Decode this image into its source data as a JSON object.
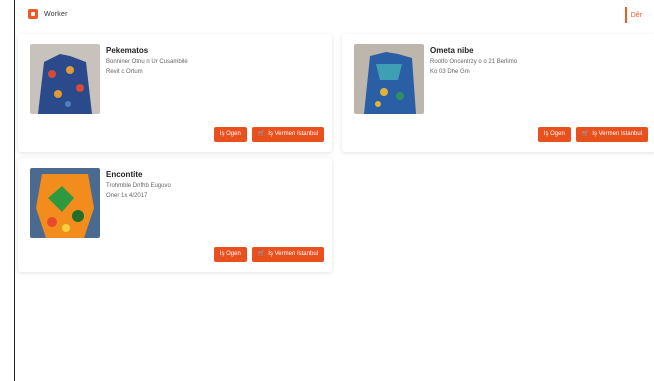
{
  "header": {
    "brand": "Worker",
    "right_label": "Dêr"
  },
  "cards": [
    {
      "title": "Pekematos",
      "line1": "Bonniner Otnu n Ur Cusambile",
      "line2": "Revit c Ortum",
      "btn_primary": "Iş Ogen",
      "btn_secondary": "Iş Vermen Istanbul"
    },
    {
      "title": "Ometa nibe",
      "line1": "Rootfo Oncentrzy o o 21 Berlimo",
      "line2": "Ko 03 Dhe Gm",
      "btn_primary": "Iş Ogen",
      "btn_secondary": "Iş Vermen Istanbul"
    },
    {
      "title": "Encontite",
      "line1": "Trohmble Dnfhb Euguvo",
      "line2": "Oner 1x 4/2017",
      "btn_primary": "Iş Ogen",
      "btn_secondary": "Iş Vermen Istanbul"
    }
  ],
  "colors": {
    "accent": "#e8501e"
  }
}
